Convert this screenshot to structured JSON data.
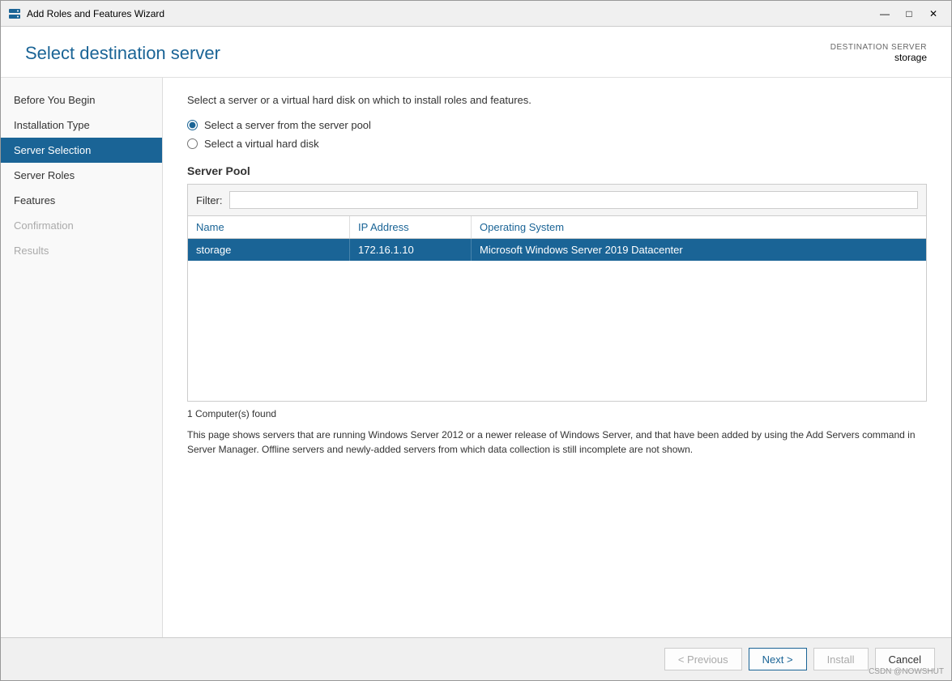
{
  "window": {
    "title": "Add Roles and Features Wizard",
    "controls": {
      "minimize": "—",
      "maximize": "□",
      "close": "✕"
    }
  },
  "header": {
    "page_title": "Select destination server",
    "destination_label": "DESTINATION SERVER",
    "destination_value": "storage"
  },
  "sidebar": {
    "items": [
      {
        "id": "before-you-begin",
        "label": "Before You Begin",
        "state": "normal"
      },
      {
        "id": "installation-type",
        "label": "Installation Type",
        "state": "normal"
      },
      {
        "id": "server-selection",
        "label": "Server Selection",
        "state": "active"
      },
      {
        "id": "server-roles",
        "label": "Server Roles",
        "state": "normal"
      },
      {
        "id": "features",
        "label": "Features",
        "state": "normal"
      },
      {
        "id": "confirmation",
        "label": "Confirmation",
        "state": "disabled"
      },
      {
        "id": "results",
        "label": "Results",
        "state": "disabled"
      }
    ]
  },
  "content": {
    "description": "Select a server or a virtual hard disk on which to install roles and features.",
    "radio_options": [
      {
        "id": "server-pool",
        "label": "Select a server from the server pool",
        "checked": true
      },
      {
        "id": "vhd",
        "label": "Select a virtual hard disk",
        "checked": false
      }
    ],
    "server_pool": {
      "title": "Server Pool",
      "filter_label": "Filter:",
      "filter_placeholder": "",
      "columns": [
        "Name",
        "IP Address",
        "Operating System"
      ],
      "rows": [
        {
          "name": "storage",
          "ip": "172.16.1.10",
          "os": "Microsoft Windows Server 2019 Datacenter",
          "selected": true
        }
      ],
      "computers_found": "1 Computer(s) found",
      "info_text": "This page shows servers that are running Windows Server 2012 or a newer release of Windows Server, and that have been added by using the Add Servers command in Server Manager. Offline servers and newly-added servers from which data collection is still incomplete are not shown."
    }
  },
  "footer": {
    "previous_label": "< Previous",
    "next_label": "Next >",
    "install_label": "Install",
    "cancel_label": "Cancel"
  },
  "watermark": "CSDN @NOWSHUT"
}
